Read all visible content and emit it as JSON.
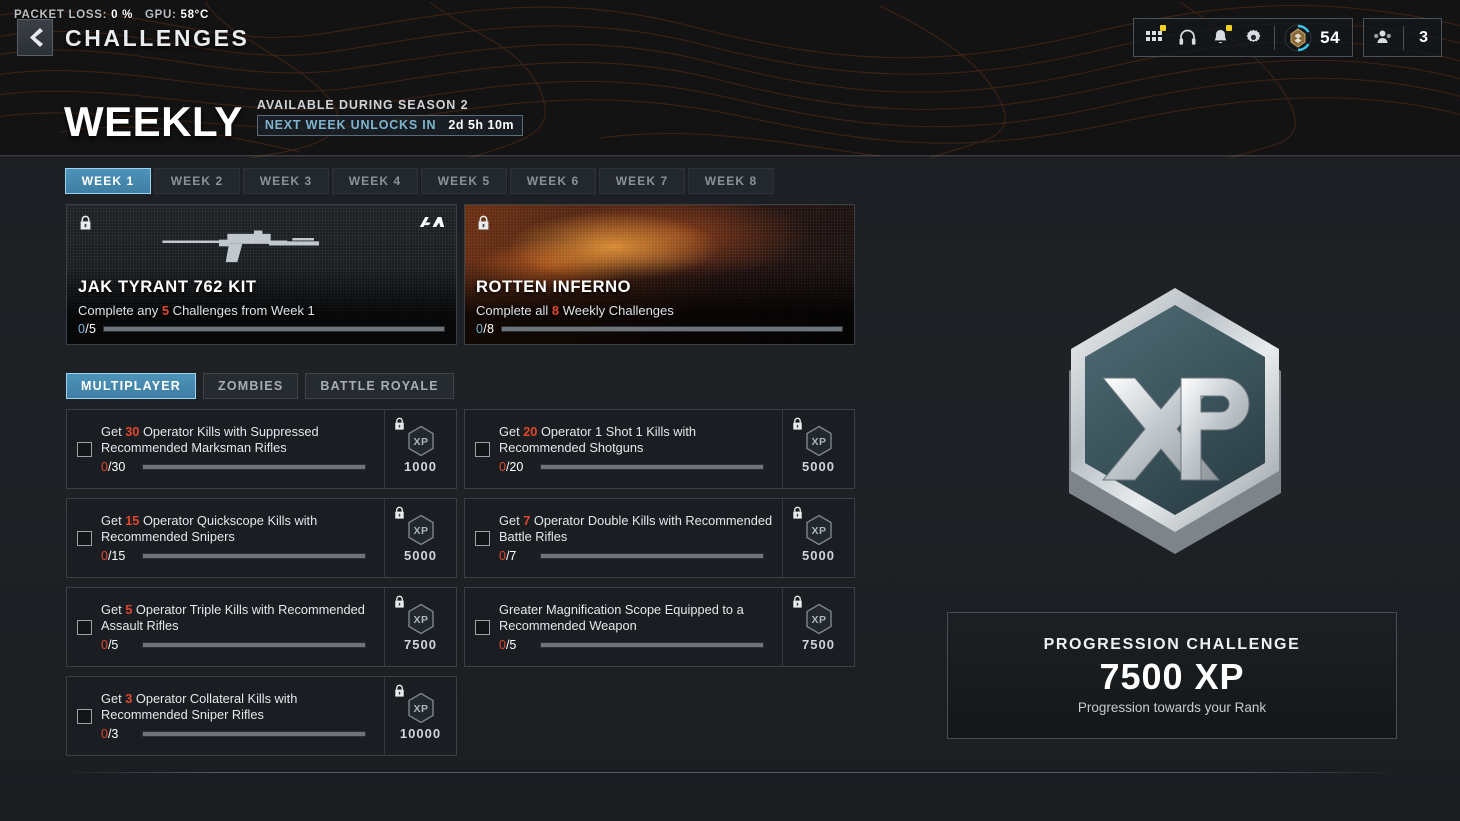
{
  "perf": {
    "packet_loss_label": "PACKET LOSS:",
    "packet_loss_value": "0 %",
    "gpu_label": "GPU:",
    "gpu_value": "58°C"
  },
  "header": {
    "back_icon": "chevron-left-icon",
    "title": "CHALLENGES",
    "icons": [
      {
        "name": "apps-grid-icon",
        "badge": true
      },
      {
        "name": "headset-icon",
        "badge": false
      },
      {
        "name": "bell-icon",
        "badge": true
      },
      {
        "name": "gear-icon",
        "badge": false
      }
    ],
    "rank_value": "54",
    "party_value": "3"
  },
  "weekly": {
    "title": "WEEKLY",
    "available": "AVAILABLE DURING SEASON 2",
    "unlock_label": "NEXT WEEK UNLOCKS IN",
    "unlock_time": "2d 5h 10m"
  },
  "week_tabs": [
    {
      "label": "WEEK 1",
      "active": true
    },
    {
      "label": "WEEK 2",
      "active": false
    },
    {
      "label": "WEEK 3",
      "active": false
    },
    {
      "label": "WEEK 4",
      "active": false
    },
    {
      "label": "WEEK 5",
      "active": false
    },
    {
      "label": "WEEK 6",
      "active": false
    },
    {
      "label": "WEEK 7",
      "active": false
    },
    {
      "label": "WEEK 8",
      "active": false
    }
  ],
  "rewards": [
    {
      "name": "JAK TYRANT 762 KIT",
      "desc_pre": "Complete any ",
      "desc_highlight": "5",
      "desc_post": " Challenges from Week 1",
      "progress_current": "0",
      "progress_total": "/5",
      "progress_pct": 0,
      "locked": true,
      "art": "weapon-blueprint"
    },
    {
      "name": "ROTTEN INFERNO",
      "desc_pre": "Complete all ",
      "desc_highlight": "8",
      "desc_post": " Weekly Challenges",
      "progress_current": "0",
      "progress_total": "/8",
      "progress_pct": 0,
      "locked": true,
      "art": "fire-camo"
    }
  ],
  "mode_tabs": [
    {
      "label": "MULTIPLAYER",
      "active": true
    },
    {
      "label": "ZOMBIES",
      "active": false
    },
    {
      "label": "BATTLE ROYALE",
      "active": false
    }
  ],
  "challenges_left": [
    {
      "desc_pre": "Get ",
      "desc_highlight": "30",
      "desc_post": " Operator Kills with Suppressed Recommended Marksman Rifles",
      "progress_current": "0",
      "progress_total": "/30",
      "progress_pct": 0,
      "xp": "1000",
      "locked": true,
      "checked": false
    },
    {
      "desc_pre": "Get ",
      "desc_highlight": "15",
      "desc_post": " Operator Quickscope Kills with Recommended Snipers",
      "progress_current": "0",
      "progress_total": "/15",
      "progress_pct": 0,
      "xp": "5000",
      "locked": true,
      "checked": false
    },
    {
      "desc_pre": "Get ",
      "desc_highlight": "5",
      "desc_post": " Operator Triple Kills with Recommended Assault Rifles",
      "progress_current": "0",
      "progress_total": "/5",
      "progress_pct": 0,
      "xp": "7500",
      "locked": true,
      "checked": false
    },
    {
      "desc_pre": "Get ",
      "desc_highlight": "3",
      "desc_post": " Operator Collateral Kills with Recommended Sniper Rifles",
      "progress_current": "0",
      "progress_total": "/3",
      "progress_pct": 0,
      "xp": "10000",
      "locked": true,
      "checked": false
    }
  ],
  "challenges_right": [
    {
      "desc_pre": "Get ",
      "desc_highlight": "20",
      "desc_post": " Operator 1 Shot 1 Kills with Recommended Shotguns",
      "progress_current": "0",
      "progress_total": "/20",
      "progress_pct": 0,
      "xp": "5000",
      "locked": true,
      "checked": false
    },
    {
      "desc_pre": "Get ",
      "desc_highlight": "7",
      "desc_post": " Operator Double Kills with Recommended Battle Rifles",
      "progress_current": "0",
      "progress_total": "/7",
      "progress_pct": 0,
      "xp": "5000",
      "locked": true,
      "checked": false
    },
    {
      "desc_pre": "",
      "desc_highlight": "",
      "desc_post": "Greater Magnification Scope Equipped to a Recommended Weapon",
      "progress_current": "0",
      "progress_total": "/5",
      "progress_pct": 0,
      "xp": "7500",
      "locked": true,
      "checked": false
    }
  ],
  "progression": {
    "title": "PROGRESSION CHALLENGE",
    "xp": "7500 XP",
    "subtitle": "Progression towards your Rank",
    "badge_text": "XP"
  },
  "colors": {
    "accent_blue": "#4d93b8",
    "highlight_red": "#e0472a",
    "badge_yellow": "#f3d21c",
    "progress_blue": "#76b6d6"
  }
}
